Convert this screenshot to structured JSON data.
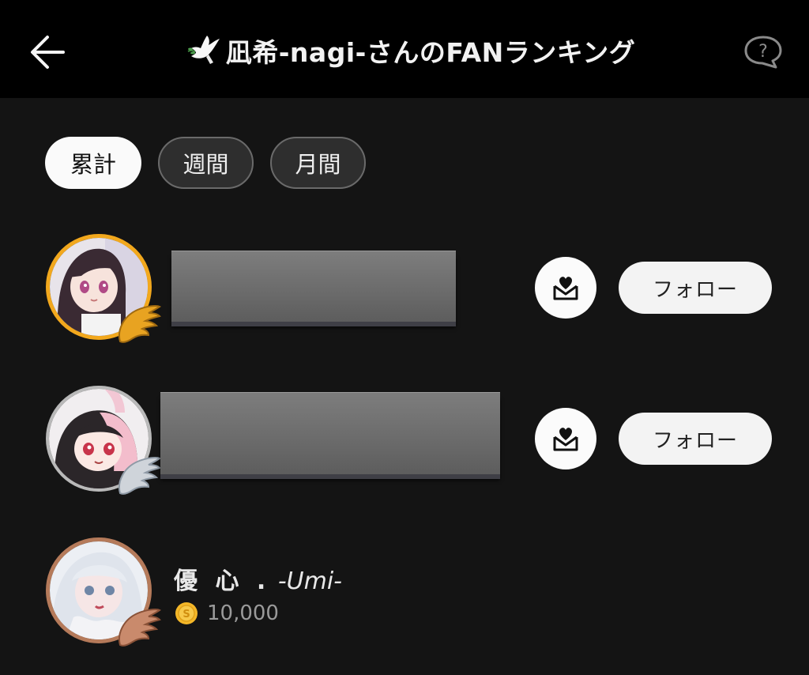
{
  "header": {
    "title": "凪希-nagi-さんのFANランキング",
    "back_icon": "arrow-left-icon",
    "help_icon": "help-bubble-icon",
    "title_icon": "dove-icon"
  },
  "tabs": [
    {
      "label": "累計",
      "active": true
    },
    {
      "label": "週間",
      "active": false
    },
    {
      "label": "月間",
      "active": false
    }
  ],
  "ranking": [
    {
      "rank": 1,
      "badge": "gold-wing",
      "name_redacted": true,
      "follow_label": "フォロー",
      "mail_icon": "heart-mail-icon"
    },
    {
      "rank": 2,
      "badge": "silver-wing",
      "name_redacted": true,
      "follow_label": "フォロー",
      "mail_icon": "heart-mail-icon"
    },
    {
      "rank": 3,
      "badge": "bronze-wing",
      "name_jp": "優 心 .",
      "name_en": " -Umi-",
      "coins": "10,000",
      "coin_icon": "coin-icon"
    }
  ],
  "colors": {
    "background": "#141414",
    "header": "#000000",
    "gold": "#f2a81d",
    "silver": "#b9b9b9",
    "bronze": "#b57a5a"
  }
}
